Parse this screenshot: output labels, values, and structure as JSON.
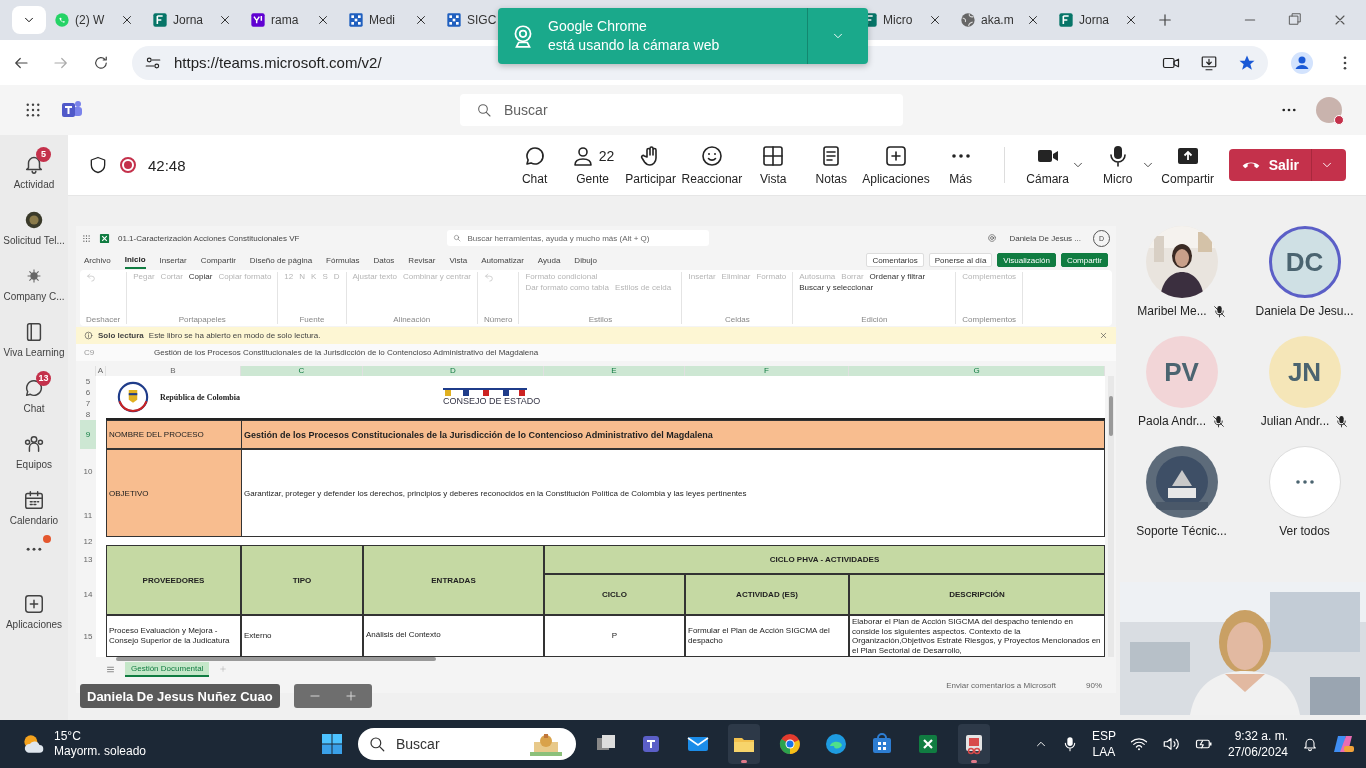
{
  "browser": {
    "tabs": [
      {
        "label": "(2) W",
        "selected": false
      },
      {
        "label": "Jorna",
        "selected": false
      },
      {
        "label": "rama",
        "selected": false
      },
      {
        "label": "Medi",
        "selected": false
      },
      {
        "label": "SIGC",
        "selected": false
      },
      {
        "label": "Micro",
        "selected": false
      },
      {
        "label": "aka.m",
        "selected": false
      },
      {
        "label": "Jorna",
        "selected": false
      }
    ],
    "toast": {
      "title": "Google Chrome",
      "message": "está usando la cámara web"
    },
    "url": "https://teams.microsoft.com/v2/"
  },
  "teams": {
    "search": {
      "placeholder": "Buscar"
    },
    "rail": [
      {
        "label": "Actividad",
        "badge": "5"
      },
      {
        "label": "Solicitud Tel..."
      },
      {
        "label": "Company C..."
      },
      {
        "label": "Viva Learning"
      },
      {
        "label": "Chat",
        "badge": "13"
      },
      {
        "label": "Equipos"
      },
      {
        "label": "Calendario"
      },
      {
        "kind": "more",
        "dot": true
      },
      {
        "label": "Aplicaciones"
      }
    ],
    "meeting": {
      "recording": true,
      "timer": "42:48",
      "tools": [
        {
          "label": "Chat"
        },
        {
          "label": "Gente",
          "count": "22"
        },
        {
          "label": "Participar"
        },
        {
          "label": "Reaccionar"
        },
        {
          "label": "Vista"
        },
        {
          "label": "Notas"
        },
        {
          "label": "Aplicaciones"
        },
        {
          "label": "Más"
        }
      ],
      "devices": [
        {
          "label": "Cámara",
          "dropdown": true
        },
        {
          "label": "Micro",
          "dropdown": true
        },
        {
          "label": "Compartir",
          "dropdown": false
        }
      ],
      "leave": "Salir"
    },
    "participants": [
      {
        "name": "Maribel Me...",
        "kind": "picture",
        "muted": true,
        "speaking": false
      },
      {
        "name": "Daniela De Jesu...",
        "kind": "initials",
        "initials": "DC",
        "color": "#cfe0e4",
        "muted": false,
        "speaking": true
      },
      {
        "name": "Paola Andr...",
        "kind": "initials",
        "initials": "PV",
        "color": "#f2d5d7",
        "muted": true,
        "speaking": false
      },
      {
        "name": "Julian Andr...",
        "kind": "initials",
        "initials": "JN",
        "color": "#f5e6b8",
        "muted": true,
        "speaking": false
      },
      {
        "name": "Soporte Técnic...",
        "kind": "picture",
        "muted": false,
        "speaking": false
      },
      {
        "name": "Ver todos",
        "kind": "more",
        "muted": false,
        "speaking": false
      }
    ],
    "presenter": "Daniela De Jesus Nuñez Cuao"
  },
  "excel": {
    "file": "01.1-Caracterización Acciones Constitucionales VF",
    "search": {
      "placeholder": "Buscar herramientas, ayuda y mucho más (Alt + Q)"
    },
    "user": "Daniela De Jesus ...",
    "avatar": "D",
    "menus": [
      {
        "label": "Archivo",
        "selected": false
      },
      {
        "label": "Inicio",
        "selected": true
      },
      {
        "label": "Insertar",
        "selected": false
      },
      {
        "label": "Compartir",
        "selected": false
      },
      {
        "label": "Diseño de página",
        "selected": false
      },
      {
        "label": "Fórmulas",
        "selected": false
      },
      {
        "label": "Datos",
        "selected": false
      },
      {
        "label": "Revisar",
        "selected": false
      },
      {
        "label": "Vista",
        "selected": false
      },
      {
        "label": "Automatizar",
        "selected": false
      },
      {
        "label": "Ayuda",
        "selected": false
      },
      {
        "label": "Dibujo",
        "selected": false
      }
    ],
    "actions": [
      {
        "label": "Comentarios",
        "kind": "plain"
      },
      {
        "label": "Ponerse al día",
        "kind": "plain"
      },
      {
        "label": "Visualización",
        "kind": "green"
      },
      {
        "label": "Compartir",
        "kind": "green"
      }
    ],
    "ribbon": [
      {
        "label": "Deshacer"
      },
      {
        "label": "Portapapeles",
        "items": [
          {
            "label": "Pegar",
            "disabled": true
          },
          {
            "label": "Cortar",
            "disabled": true
          },
          {
            "label": "Copiar",
            "disabled": false
          },
          {
            "label": "Copiar formato",
            "disabled": true
          }
        ]
      },
      {
        "label": "Fuente",
        "items": [
          {
            "label": "12",
            "disabled": true
          },
          {
            "label": "N",
            "disabled": true
          },
          {
            "label": "K",
            "disabled": true
          },
          {
            "label": "S",
            "disabled": true
          },
          {
            "label": "D",
            "disabled": true
          }
        ]
      },
      {
        "label": "Alineación",
        "items": [
          {
            "label": "Ajustar texto",
            "disabled": true
          },
          {
            "label": "Combinar y centrar",
            "disabled": true
          }
        ]
      },
      {
        "label": "Número"
      },
      {
        "label": "Estilos",
        "items": [
          {
            "label": "Formato condicional",
            "disabled": true
          },
          {
            "label": "Dar formato como tabla",
            "disabled": true
          },
          {
            "label": "Estilos de celda",
            "disabled": true
          }
        ]
      },
      {
        "label": "Celdas",
        "items": [
          {
            "label": "Insertar",
            "disabled": true
          },
          {
            "label": "Eliminar",
            "disabled": true
          },
          {
            "label": "Formato",
            "disabled": true
          }
        ]
      },
      {
        "label": "Edición",
        "items": [
          {
            "label": "Autosuma",
            "disabled": true
          },
          {
            "label": "Borrar",
            "disabled": true
          },
          {
            "label": "Ordenar y filtrar",
            "disabled": false
          },
          {
            "label": "Buscar y seleccionar",
            "disabled": false
          }
        ]
      },
      {
        "label": "Complementos",
        "items": [
          {
            "label": "Complementos",
            "disabled": true
          }
        ]
      }
    ],
    "notice": {
      "title": "Solo lectura",
      "message": "Este libro se ha abierto en modo de solo lectura."
    },
    "formula": {
      "cell": "C9",
      "value": "Gestión de los Procesos Constitucionales de la Jurisdicción de lo Contencioso Administrativo del Magdalena"
    },
    "columns": [
      {
        "label": "A",
        "selected": false
      },
      {
        "label": "B",
        "selected": false
      },
      {
        "label": "C",
        "selected": true
      },
      {
        "label": "D",
        "selected": true
      },
      {
        "label": "E",
        "selected": true
      },
      {
        "label": "F",
        "selected": true
      },
      {
        "label": "G",
        "selected": true
      }
    ],
    "rows": [
      {
        "label": "5",
        "selected": false
      },
      {
        "label": "6",
        "selected": false
      },
      {
        "label": "7",
        "selected": false
      },
      {
        "label": "8",
        "selected": false
      },
      {
        "label": "9",
        "selected": true
      },
      {
        "label": "10",
        "selected": false
      },
      {
        "label": "11",
        "selected": false
      },
      {
        "label": "12",
        "selected": false
      },
      {
        "label": "13",
        "selected": false
      },
      {
        "label": "14",
        "selected": false
      },
      {
        "label": "15",
        "selected": false
      }
    ],
    "logos": [
      "República de Colombia",
      "CONSEJO DE ESTADO"
    ],
    "process": {
      "label": "NOMBRE DEL PROCESO",
      "value": "Gestión de los Procesos Constitucionales de la Jurisdicción de lo Contencioso Administrativo del Magdalena"
    },
    "objective": {
      "label": "OBJETIVO",
      "value": "Garantizar, proteger y defender los derechos, principios y deberes reconocidos en la Constitución Política de Colombia y las leyes pertinentes"
    },
    "table": {
      "headers": [
        "PROVEEDORES",
        "TIPO",
        "ENTRADAS"
      ],
      "group": "CICLO PHVA - ACTIVIDADES",
      "subheaders": [
        "CICLO",
        "ACTIVIDAD (ES)",
        "DESCRIPCIÓN"
      ],
      "row": [
        "Proceso Evaluación y Mejora - Consejo Superior de la Judicatura",
        "Externo",
        "Análisis del Contexto",
        "P",
        "Formular el Plan de Acción SIGCMA del despacho",
        "Elaborar el Plan de Acción SIGCMA del despacho teniendo en conside los siguientes aspectos. Contexto de la Organización,Objetivos Estraté Riesgos, y Proyectos Mencionados en el Plan Sectorial de Desarrollo,"
      ]
    },
    "sheets": [
      {
        "label": "Gestión Documental",
        "selected": true
      }
    ],
    "status": {
      "feedback": "Enviar comentarios a Microsoft",
      "zoom": "90%"
    }
  },
  "taskbar": {
    "weather": {
      "temp": "15°C",
      "text": "Mayorm. soleado"
    },
    "search": {
      "placeholder": "Buscar"
    },
    "apps": [
      {
        "active": false
      },
      {
        "active": false
      },
      {
        "active": false
      },
      {
        "active": true
      },
      {
        "active": false
      },
      {
        "active": false
      },
      {
        "active": false
      },
      {
        "active": false
      },
      {
        "active": true
      }
    ],
    "lang": "ESP",
    "layout": "LAA",
    "time": "9:32 a. m.",
    "date": "27/06/2024"
  }
}
